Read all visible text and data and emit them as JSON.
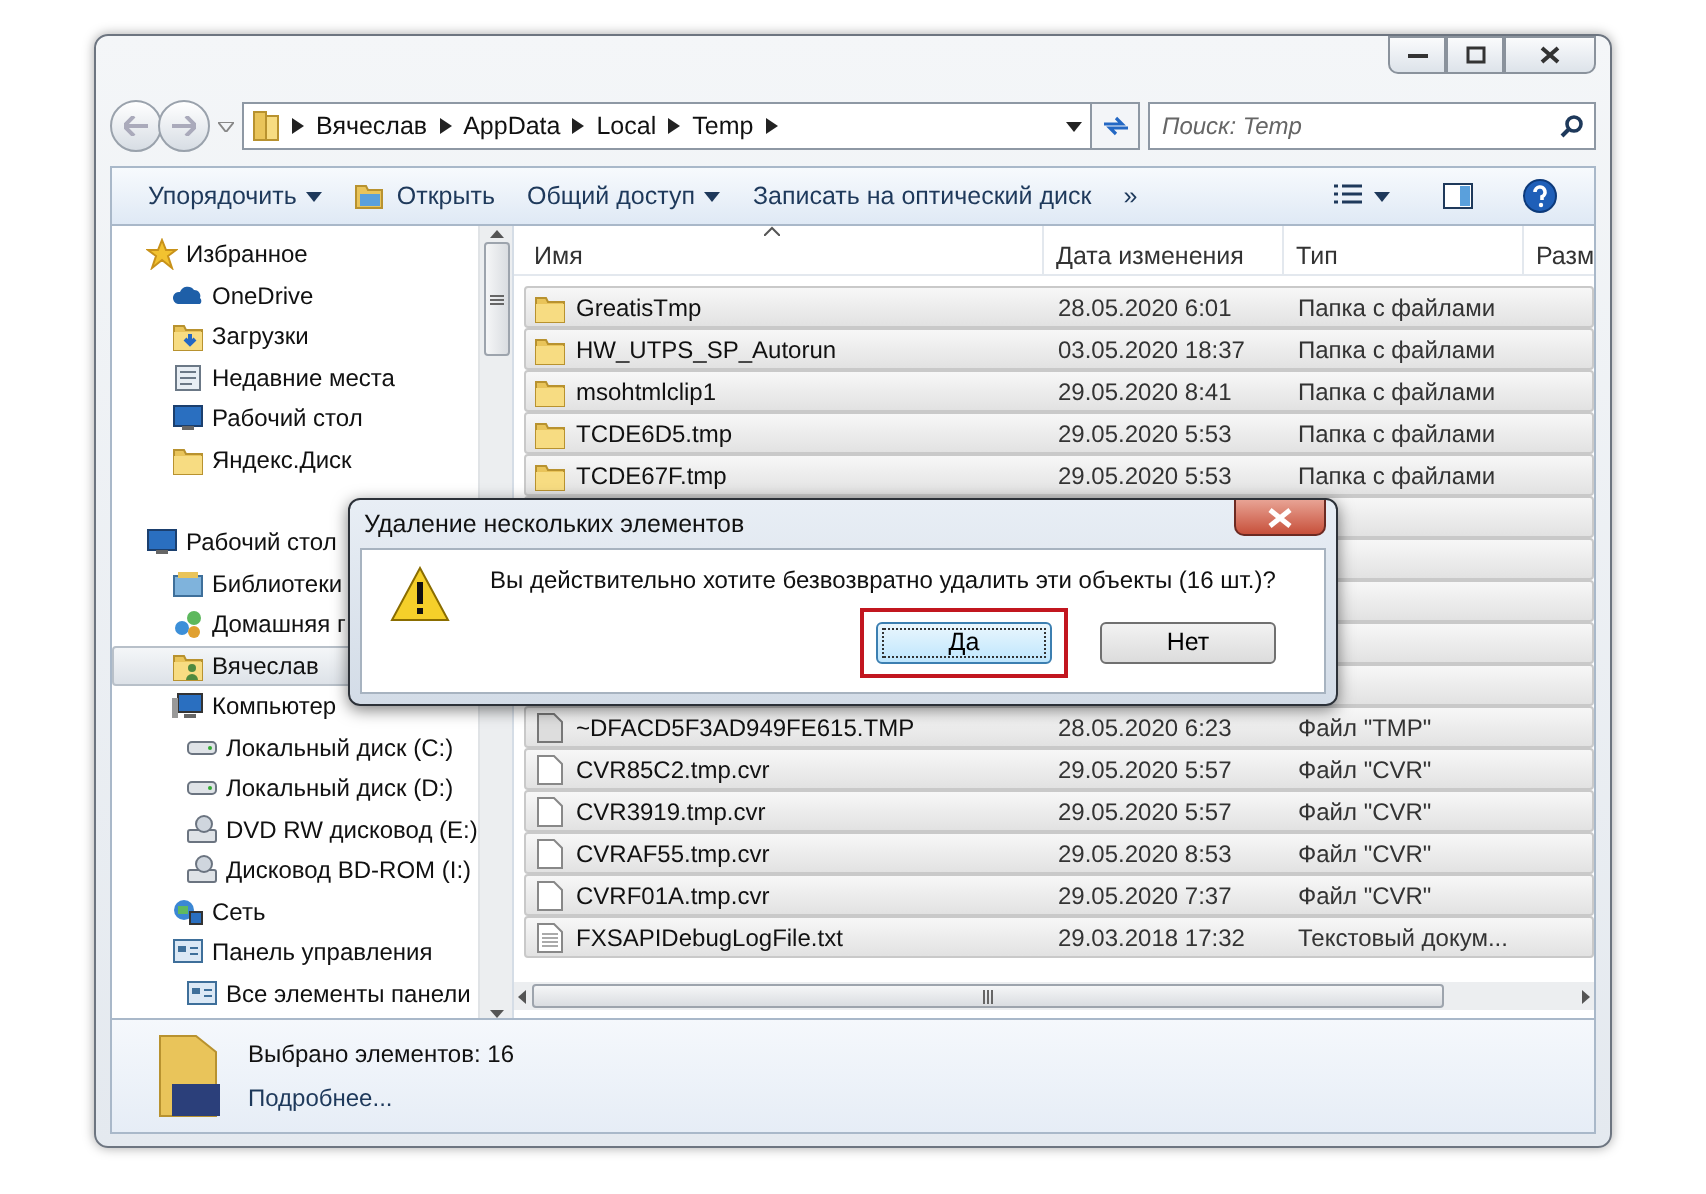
{
  "window": {
    "address": [
      "Вячеслав",
      "AppData",
      "Local",
      "Temp"
    ],
    "search": {
      "placeholder": "Поиск: Temp"
    }
  },
  "toolbar": [
    {
      "kind": "menu",
      "label": "Упорядочить"
    },
    {
      "kind": "open",
      "label": "Открыть"
    },
    {
      "kind": "menu",
      "label": "Общий доступ"
    },
    {
      "kind": "plain",
      "label": "Записать на оптический диск"
    },
    {
      "kind": "plain",
      "label": "»"
    }
  ],
  "sidebar": {
    "items": [
      {
        "label": "Избранное",
        "kind": "star",
        "selected": false,
        "children": [
          {
            "label": "OneDrive",
            "kind": "cloud",
            "selected": false
          },
          {
            "label": "Загрузки",
            "kind": "downloads",
            "selected": false
          },
          {
            "label": "Недавние места",
            "kind": "recent",
            "selected": false
          },
          {
            "label": "Рабочий стол",
            "kind": "desktop",
            "selected": false
          },
          {
            "label": "Яндекс.Диск",
            "kind": "folder",
            "selected": false
          }
        ]
      },
      {
        "label": "Рабочий стол",
        "kind": "desktop",
        "selected": false,
        "children": [
          {
            "label": "Библиотеки",
            "kind": "library",
            "selected": false
          },
          {
            "label": "Домашняя г",
            "kind": "homegroup",
            "selected": false
          },
          {
            "label": "Вячеслав",
            "kind": "user",
            "selected": true
          },
          {
            "label": "Компьютер",
            "kind": "computer",
            "selected": false,
            "children": [
              {
                "label": "Локальный диск (C:)",
                "kind": "drive",
                "selected": false
              },
              {
                "label": "Локальный диск (D:)",
                "kind": "drive",
                "selected": false
              },
              {
                "label": "DVD RW дисковод (E:)",
                "kind": "optical",
                "selected": false
              },
              {
                "label": "Дисковод BD-ROM (I:)",
                "kind": "optical",
                "selected": false
              }
            ]
          },
          {
            "label": "Сеть",
            "kind": "network",
            "selected": false
          },
          {
            "label": "Панель управления",
            "kind": "panel",
            "selected": false,
            "children": [
              {
                "label": "Все элементы панели",
                "kind": "panel",
                "selected": false
              }
            ]
          }
        ]
      }
    ]
  },
  "table": {
    "columns": [
      "Имя",
      "Дата изменения",
      "Тип",
      "Разм"
    ],
    "rows": [
      {
        "kind": "folder",
        "selected": true,
        "name": "GreatisTmp",
        "date": "28.05.2020 6:01",
        "type": "Папка с файлами"
      },
      {
        "kind": "folder",
        "selected": true,
        "name": "HW_UTPS_SP_Autorun",
        "date": "03.05.2020 18:37",
        "type": "Папка с файлами"
      },
      {
        "kind": "folder",
        "selected": true,
        "name": "msohtmlclip1",
        "date": "29.05.2020 8:41",
        "type": "Папка с файлами"
      },
      {
        "kind": "folder",
        "selected": true,
        "name": "TCDE6D5.tmp",
        "date": "29.05.2020 5:53",
        "type": "Папка с файлами"
      },
      {
        "kind": "folder",
        "selected": true,
        "name": "TCDE67F.tmp",
        "date": "29.05.2020 5:53",
        "type": "Папка с файлами"
      },
      {
        "kind": "covered",
        "selected": true
      },
      {
        "kind": "covered",
        "selected": true
      },
      {
        "kind": "covered",
        "selected": true
      },
      {
        "kind": "covered",
        "selected": true
      },
      {
        "kind": "covered",
        "selected": true
      },
      {
        "kind": "tmp",
        "selected": true,
        "name": "~DFACD5F3AD949FE615.TMP",
        "date": "28.05.2020 6:23",
        "type": "Файл \"TMP\""
      },
      {
        "kind": "file",
        "selected": true,
        "name": "CVR85C2.tmp.cvr",
        "date": "29.05.2020 5:57",
        "type": "Файл \"CVR\""
      },
      {
        "kind": "file",
        "selected": true,
        "name": "CVR3919.tmp.cvr",
        "date": "29.05.2020 5:57",
        "type": "Файл \"CVR\""
      },
      {
        "kind": "file",
        "selected": true,
        "name": "CVRAF55.tmp.cvr",
        "date": "29.05.2020 8:53",
        "type": "Файл \"CVR\""
      },
      {
        "kind": "file",
        "selected": true,
        "name": "CVRF01A.tmp.cvr",
        "date": "29.05.2020 7:37",
        "type": "Файл \"CVR\""
      },
      {
        "kind": "text",
        "selected": true,
        "name": "FXSAPIDebugLogFile.txt",
        "date": "29.03.2018 17:32",
        "type": "Текстовый докум..."
      }
    ]
  },
  "details": {
    "count": "Выбрано элементов: 16",
    "more": "Подробнее..."
  },
  "dialog": {
    "title": "Удаление нескольких элементов",
    "message": "Вы действительно хотите безвозвратно удалить эти объекты (16 шт.)?",
    "buttons": [
      {
        "label": "Да",
        "highlighted": true
      },
      {
        "label": "Нет",
        "highlighted": false
      }
    ]
  }
}
